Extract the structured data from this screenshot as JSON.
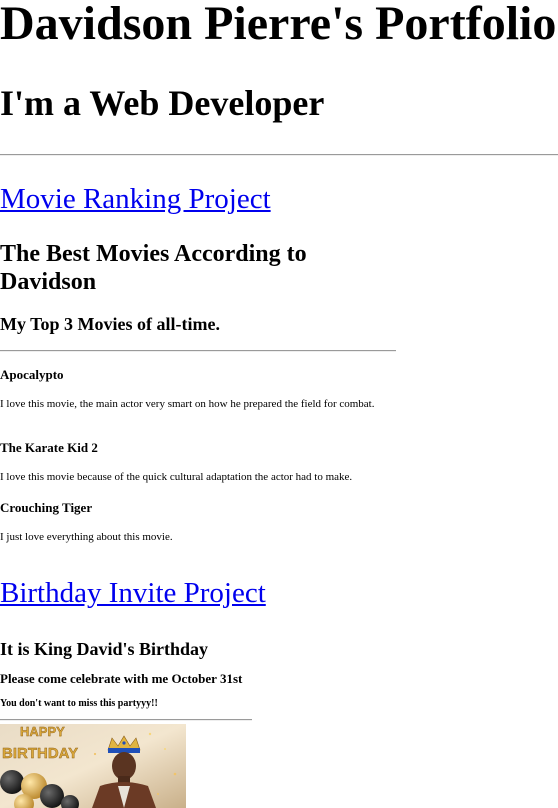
{
  "header": {
    "title": "Davidson Pierre's Portfolio",
    "subtitle": "I'm a Web Developer"
  },
  "movie_project": {
    "link_label": "Movie Ranking Project",
    "heading": "The Best Movies According to Davidson",
    "subheading": "My Top 3 Movies of all-time.",
    "movies": [
      {
        "title": "Apocalypto",
        "description": "I love this movie, the main actor very smart on how he prepared the field for combat."
      },
      {
        "title": "The Karate Kid 2",
        "description": "I love this movie because of the quick cultural adaptation the actor had to make."
      },
      {
        "title": "Crouching Tiger",
        "description": "I just love everything about this movie."
      }
    ]
  },
  "birthday_project": {
    "link_label": "Birthday Invite Project",
    "heading": "It is King David's Birthday",
    "subheading": "Please come celebrate with me October 31st",
    "note": "You don't want to miss this partyyy!!",
    "image_text": "HAPPY BIRTHDAY",
    "colors": {
      "gold": "#d9a73a",
      "crown_blue": "#1f4fb8",
      "balloon_black": "#1a1a1a"
    }
  },
  "colors": {
    "link": "#0000ee",
    "text": "#000000",
    "rule": "#9a9a9a"
  }
}
